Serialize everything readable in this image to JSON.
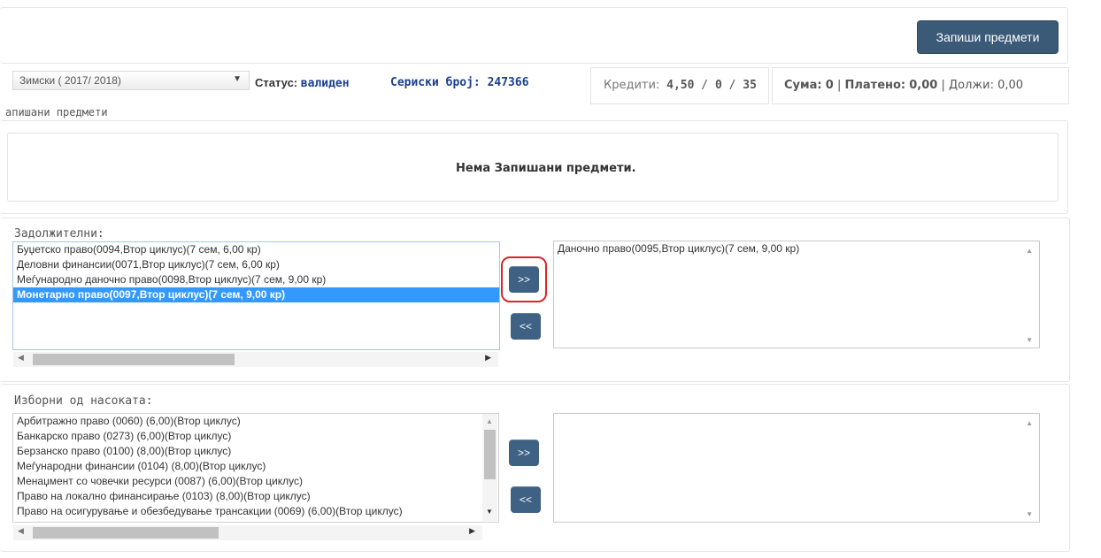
{
  "header": {
    "enroll_button": "Запиши предмети"
  },
  "semester_select": {
    "value": "Зимски ( 2017/ 2018)"
  },
  "status": {
    "label": "Статус:",
    "value": "валиден"
  },
  "serial": {
    "text": "Сериски број: 247366"
  },
  "credits": {
    "label": "Кредити:",
    "value": "4,50",
    "sep1": "/",
    "v2": "0",
    "sep2": "/",
    "v3": "35"
  },
  "payment": {
    "sum_label": "Сума:",
    "sum": "0",
    "paid_label": "Платено:",
    "paid": "0,00",
    "owed_label": "Должи:",
    "owed": "0,00",
    "sep": "|"
  },
  "enrolled": {
    "title": "апишани предмети",
    "empty_message": "Нема Запишани предмети."
  },
  "mandatory": {
    "label": "Задолжителни:",
    "available": [
      "Буџетско право(0094,Втор циклус)(7 сем, 6,00 кр)",
      "Деловни финансии(0071,Втор циклус)(7 сем, 6,00 кр)",
      "Меѓународно даночно право(0098,Втор циклус)(7 сем, 9,00 кр)",
      "Монетарно право(0097,Втор циклус)(7 сем, 9,00 кр)"
    ],
    "selected_index": 3,
    "chosen": [
      "Даночно право(0095,Втор циклус)(7 сем, 9,00 кр)"
    ],
    "add_label": ">>",
    "remove_label": "<<"
  },
  "electives": {
    "label": "Изборни од насоката:",
    "available": [
      "Арбитражно право (0060) (6,00)(Втор циклус)",
      "Банкарско право (0273) (6,00)(Втор циклус)",
      "Берзанско право (0100) (8,00)(Втор циклус)",
      "Меѓународни финансии (0104) (8,00)(Втор циклус)",
      "Менаџмент со човечки ресурси (0087) (6,00)(Втор циклус)",
      "Право на локално финансирање (0103) (8,00)(Втор циклус)",
      "Право на осигурување и обезбедување трансакции (0069) (6,00)(Втор циклус)"
    ],
    "chosen": [],
    "add_label": ">>",
    "remove_label": "<<"
  },
  "colors": {
    "primary": "#3b5a78",
    "link_blue": "#1b3f8f",
    "selection": "#3399ff",
    "annotation_red": "#d9262a"
  }
}
